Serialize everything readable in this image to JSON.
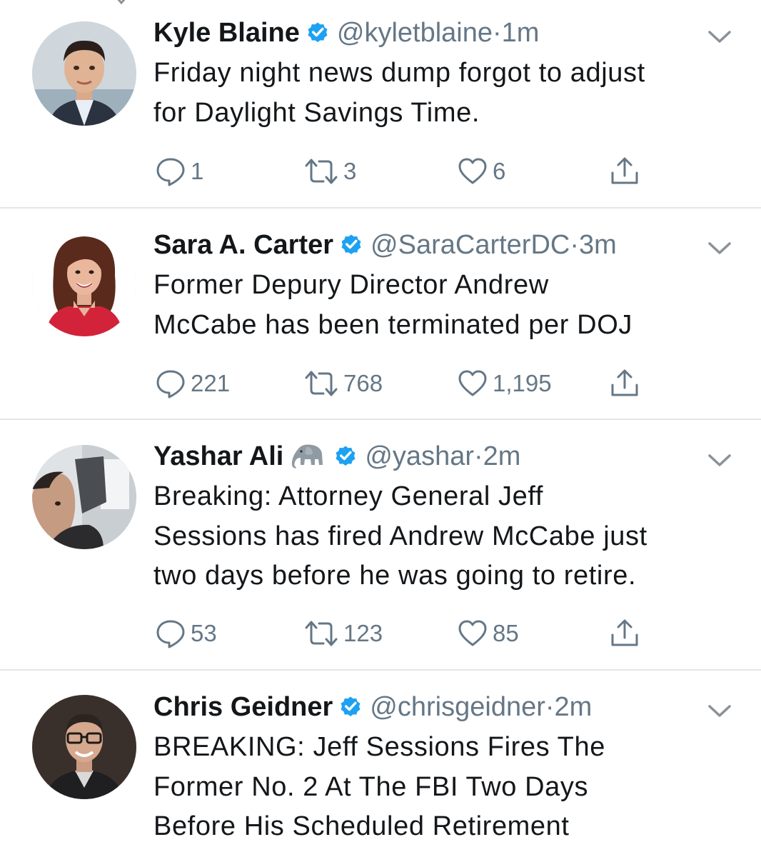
{
  "colors": {
    "verified": "#1da1f2",
    "secondary_text": "#657786",
    "text": "#14171a",
    "divider": "#e3e6e8"
  },
  "icons": {
    "verified": "verified-badge-icon",
    "reply": "reply-bubble-icon",
    "retweet": "retweet-arrows-icon",
    "like": "heart-icon",
    "share": "share-upload-icon",
    "menu": "chevron-down-icon",
    "emoji": "elephant-emoji-icon"
  },
  "tweets": [
    {
      "name": "Kyle Blaine",
      "verified": true,
      "handle": "@kyletblaine",
      "separator": "·",
      "time": "1m",
      "text_lines": [
        "Friday night news dump forgot to adjust",
        "for Daylight Savings Time."
      ],
      "replies": "1",
      "retweets": "3",
      "likes": "6"
    },
    {
      "name": "Sara A. Carter",
      "verified": true,
      "handle": "@SaraCarterDC",
      "separator": "·",
      "time": "3m",
      "text_lines": [
        "Former Depury Director Andrew",
        "McCabe has been terminated per DOJ"
      ],
      "replies": "221",
      "retweets": "768",
      "likes": "1,195"
    },
    {
      "name": "Yashar Ali",
      "emoji": "🐘",
      "verified": true,
      "handle": "@yashar",
      "separator": "·",
      "time": "2m",
      "text_lines": [
        "Breaking: Attorney General Jeff",
        "Sessions has fired Andrew McCabe just",
        "two days before he was going to retire."
      ],
      "replies": "53",
      "retweets": "123",
      "likes": "85"
    },
    {
      "name": "Chris Geidner",
      "verified": true,
      "handle": "@chrisgeidner",
      "separator": "·",
      "time": "2m",
      "text_lines": [
        "BREAKING: Jeff Sessions Fires The",
        "Former No. 2 At The FBI Two Days",
        "Before His Scheduled Retirement"
      ]
    }
  ]
}
